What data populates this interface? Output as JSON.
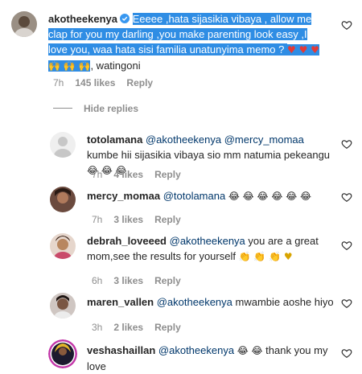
{
  "comments": [
    {
      "user": "akotheekenya",
      "verified": true,
      "text": "Eeeee ,hata sijasikia vibaya , allow me clap for you my darling ,you make parenting look easy ,I love you, waa hata sisi familia unatunyima memo ?",
      "emojis": "♥ ♥ ♥ 🙌 🙌 🙌",
      "tail": ", watingoni",
      "time": "7h",
      "likes": "145 likes",
      "reply": "Reply"
    },
    {
      "user": "totolamana",
      "mentions": "@akotheekenya @mercy_momaa",
      "text": " kumbe hii sijasikia vibaya sio mm natumia pekeangu",
      "emojis": "😂 😂 😂",
      "time": "7h",
      "likes": "4 likes",
      "reply": "Reply"
    },
    {
      "user": "mercy_momaa",
      "mentions": "@totolamana",
      "text": "",
      "emojis": "😂 😂 😂 😂 😂 😂",
      "time": "7h",
      "likes": "3 likes",
      "reply": "Reply"
    },
    {
      "user": "debrah_loveeed",
      "mentions": "@akotheekenya",
      "text": " you are a great mom,see the results for yourself",
      "emojis": "👏 👏 👏 ♥",
      "time": "6h",
      "likes": "3 likes",
      "reply": "Reply"
    },
    {
      "user": "maren_vallen",
      "mentions": "@akotheekenya",
      "text": " mwambie aoshe hiyo",
      "emojis": "",
      "time": "3h",
      "likes": "2 likes",
      "reply": "Reply"
    },
    {
      "user": "veshashaillan",
      "mentions": "@akotheekenya",
      "text": " thank you my love",
      "emojis": "😂 😂",
      "time": "",
      "likes": "",
      "reply": ""
    }
  ],
  "hide_replies": "Hide replies",
  "colors": {
    "selection": "#2f8de4",
    "mention": "#00376b",
    "meta": "#8e8e8e",
    "heart": "#e53935"
  },
  "icons": {
    "like": "heart-outline-icon",
    "verified": "verified-badge-icon"
  }
}
